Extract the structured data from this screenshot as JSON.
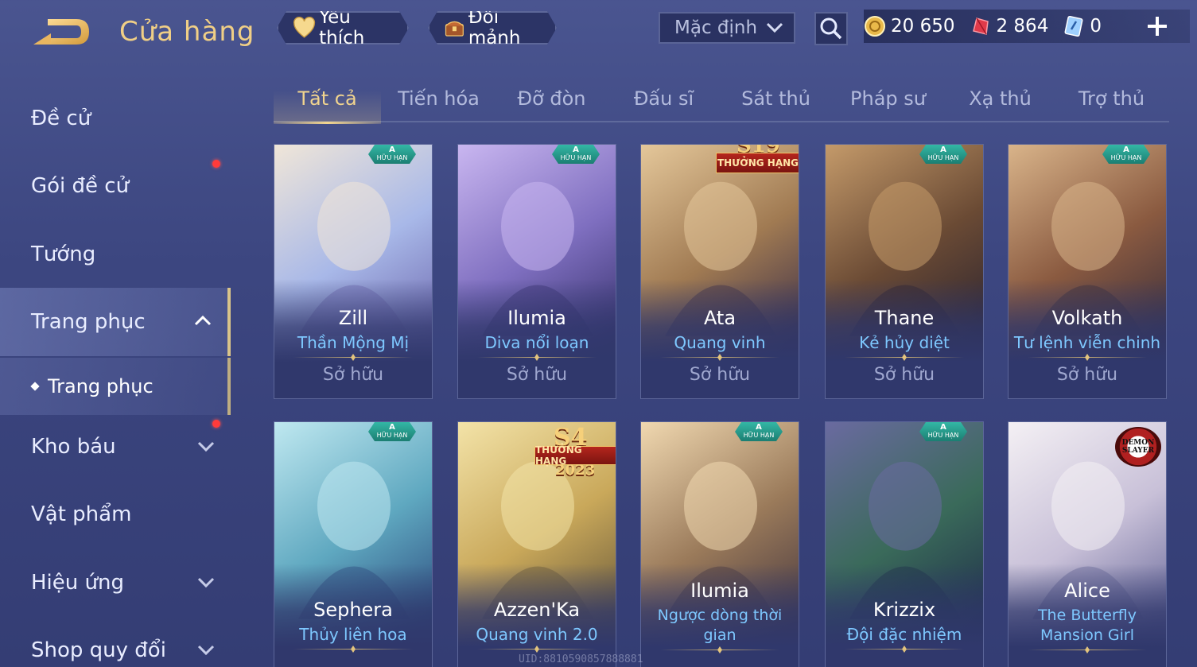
{
  "header": {
    "title": "Cửa hàng",
    "favorite_label": "Yêu thích",
    "trade_label": "Đổi mảnh",
    "sort_value": "Mặc định",
    "currencies": {
      "gold": "20 650",
      "vouchers": "2 864",
      "coupons": "0"
    }
  },
  "sidebar": {
    "items": [
      {
        "label": "Đề cử"
      },
      {
        "label": "Gói đề cử"
      },
      {
        "label": "Tướng"
      },
      {
        "label": "Trang phục"
      },
      {
        "label": "Kho báu"
      },
      {
        "label": "Vật phẩm"
      },
      {
        "label": "Hiệu ứng"
      },
      {
        "label": "Shop quy đổi"
      }
    ],
    "sub_item": "Trang phục"
  },
  "tabs": [
    "Tất cả",
    "Tiến hóa",
    "Đỡ đòn",
    "Đấu sĩ",
    "Sát thủ",
    "Pháp sư",
    "Xạ thủ",
    "Trợ thủ"
  ],
  "badges": {
    "limited_top": "A",
    "limited_bottom": "HỮU HẠN",
    "season_s19": "S19",
    "season_label": "THƯỞNG HẠNG",
    "season_s4": "S4",
    "season_year": "2023",
    "demon_slayer": "DEMON SLAYER"
  },
  "cards": [
    {
      "hero": "Zill",
      "skin": "Thần Mộng Mị",
      "status": "Sở hữu",
      "badge": "limited",
      "colors": [
        "#f0e6d8",
        "#a8b8e8",
        "#6f6ab0"
      ]
    },
    {
      "hero": "Ilumia",
      "skin": "Diva nổi loạn",
      "status": "Sở hữu",
      "badge": "limited",
      "colors": [
        "#c9b6f0",
        "#7f6fc0",
        "#3a3470"
      ]
    },
    {
      "hero": "Ata",
      "skin": "Quang vinh",
      "status": "Sở hữu",
      "badge": "season19",
      "colors": [
        "#e4c79a",
        "#a07a52",
        "#3e3048"
      ]
    },
    {
      "hero": "Thane",
      "skin": "Kẻ hủy diệt",
      "status": "Sở hữu",
      "badge": "limited",
      "colors": [
        "#c49a6a",
        "#6a4a34",
        "#2c2430"
      ]
    },
    {
      "hero": "Volkath",
      "skin": "Tư lệnh viễn chinh",
      "status": "Sở hữu",
      "badge": "limited",
      "colors": [
        "#d9b48a",
        "#8a5a40",
        "#3a2e3c"
      ]
    },
    {
      "hero": "Sephera",
      "skin": "Thủy liên hoa",
      "status": "",
      "badge": "limited",
      "colors": [
        "#bfe8f0",
        "#5fa8c0",
        "#2e4e80"
      ]
    },
    {
      "hero": "Azzen'Ka",
      "skin": "Quang vinh 2.0",
      "status": "",
      "badge": "season4",
      "colors": [
        "#f3e3a8",
        "#c9a85a",
        "#6a5a3a"
      ]
    },
    {
      "hero": "Ilumia",
      "skin": "Ngược dòng thời gian",
      "status": "",
      "badge": "limited",
      "colors": [
        "#f0d8b0",
        "#9a7a5a",
        "#4a3a40"
      ]
    },
    {
      "hero": "Krizzix",
      "skin": "Đội đặc nhiệm",
      "status": "",
      "badge": "limited",
      "colors": [
        "#6a6aa0",
        "#3a6a5a",
        "#20304a"
      ]
    },
    {
      "hero": "Alice",
      "skin": "The Butterfly Mansion Girl",
      "status": "",
      "badge": "demon",
      "colors": [
        "#f4f0f4",
        "#c8c0d8",
        "#6a6a9a"
      ]
    }
  ],
  "footer": {
    "uid": "UID:8810590857888881"
  }
}
